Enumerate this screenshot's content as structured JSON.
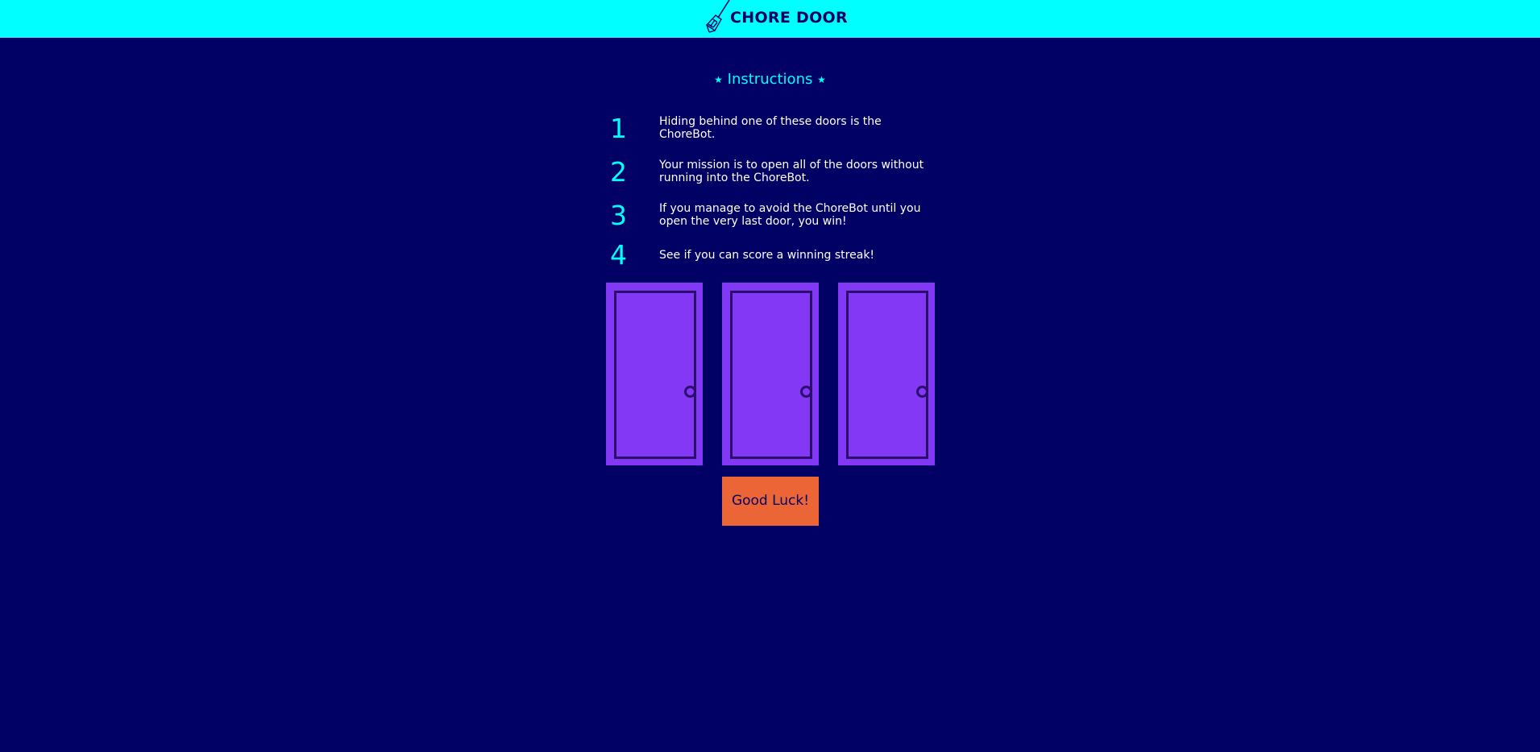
{
  "header": {
    "logo_icon": "broom-icon",
    "title": "CHORE DOOR"
  },
  "instructions": {
    "heading": "Instructions",
    "heading_star_icon": "star-icon",
    "steps": [
      {
        "number": "1",
        "text": "Hiding behind one of these doors is the ChoreBot."
      },
      {
        "number": "2",
        "text": "Your mission is to open all of the doors without running into the ChoreBot."
      },
      {
        "number": "3",
        "text": "If you manage to avoid the ChoreBot until you open the very last door, you win!"
      },
      {
        "number": "4",
        "text": "See if you can score a winning streak!"
      }
    ]
  },
  "doors": {
    "count": 3,
    "icon": "closed-door-icon"
  },
  "start_button": {
    "label": "Good Luck!"
  },
  "colors": {
    "background": "#010165",
    "header": "#00ffff",
    "accent": "#00ffff",
    "door": "#8338f6",
    "door_outline": "#2a0f6b",
    "button": "#eb6536"
  }
}
